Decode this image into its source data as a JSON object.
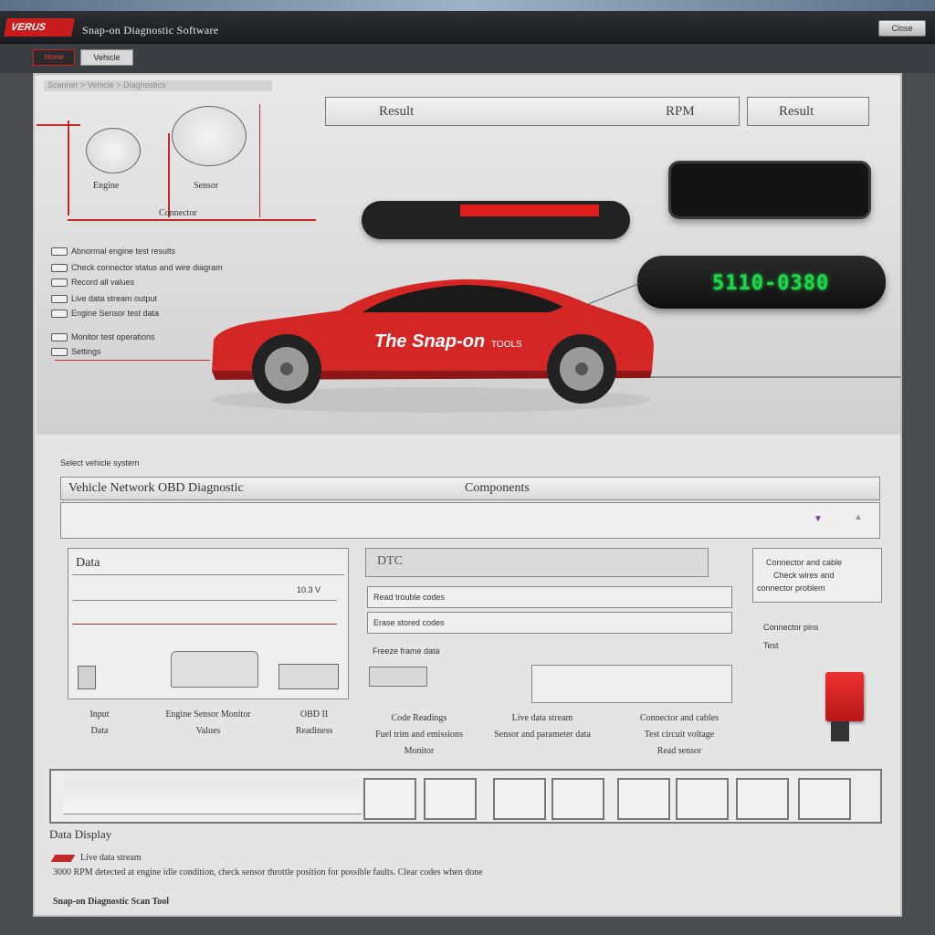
{
  "window": {
    "logo": "VERUS",
    "title": "Snap-on Diagnostic Software",
    "close_button": "Close"
  },
  "tabs": {
    "tab1": "Home",
    "tab2": "Vehicle"
  },
  "breadcrumb": "Scanner > Vehicle > Diagnostics",
  "diagram": {
    "left_label": "Engine",
    "right_label": "Sensor",
    "bottom_label": "Connector"
  },
  "fields": {
    "field_left": "Result",
    "field_left_value": "RPM",
    "field_right": "Result"
  },
  "display_readout": "5110-0380",
  "options": [
    "Abnormal engine test results",
    "Check connector status and wire diagram",
    "Record all values",
    "Live data stream output",
    "Engine Sensor test data",
    "Monitor test operations",
    "Settings"
  ],
  "vehicle": {
    "brand_text": "The Snap-on",
    "brand_sub": "TOOLS"
  },
  "section": {
    "title": "Select vehicle system",
    "dropdown_value": "Vehicle Network OBD Diagnostic",
    "dropdown_right": "Components"
  },
  "left_card": {
    "title": "Data",
    "value": "10.3 V"
  },
  "mid_card": {
    "title": "DTC",
    "line1": "Read trouble codes",
    "line2": "Erase stored codes",
    "line3": "Freeze frame data"
  },
  "note_box": {
    "text1": "Connector and cable",
    "text2": "Check wires and",
    "text3": "connector problem"
  },
  "right_labels": {
    "l1": "Connector pins",
    "l2": "Test"
  },
  "captions": [
    {
      "line1": "Input",
      "line2": "Data"
    },
    {
      "line1": "Engine Sensor Monitor",
      "line2": "Values"
    },
    {
      "line1": "OBD II",
      "line2": "Readiness"
    },
    {
      "line1": "Code Readings",
      "line2": "Fuel trim and emissions",
      "line3": "Monitor"
    },
    {
      "line1": "Live data stream",
      "line2": "Sensor and parameter data"
    },
    {
      "line1": "Connector and cables",
      "line2": "Test circuit voltage",
      "line3": "Read sensor"
    }
  ],
  "footer": {
    "title": "Data Display",
    "line1": "Live data stream",
    "line2": "3000 RPM detected at engine idle condition, check sensor throttle position for possible faults. Clear codes when done",
    "line3": "Snap-on Diagnostic Scan Tool"
  },
  "colors": {
    "accent_red": "#c91d1d",
    "display_green": "#1fd94a"
  }
}
